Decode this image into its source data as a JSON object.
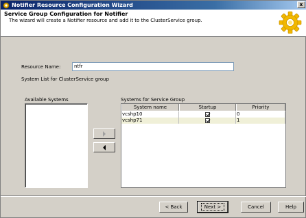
{
  "window": {
    "title": "Notifier Resource Configuration Wizard",
    "close_label": "x"
  },
  "header": {
    "title": "Service Group Configuration for Notifier",
    "subtitle": "The wizard will create a Notifier resource and add it to the ClusterService group."
  },
  "form": {
    "resource_name_label": "Resource Name:",
    "resource_name_value": "ntfr",
    "system_list_label": "System List for ClusterService group",
    "available_systems_label": "Available Systems",
    "systems_for_group_label": "Systems for Service Group"
  },
  "grid": {
    "columns": [
      "System name",
      "Startup",
      "Priority"
    ],
    "rows": [
      {
        "system": "vcshp10",
        "startup": true,
        "priority": "0"
      },
      {
        "system": "vcshp71",
        "startup": true,
        "priority": "1"
      }
    ]
  },
  "buttons": {
    "back": "< Back",
    "next": "Next >",
    "cancel": "Cancel",
    "help": "Help"
  },
  "icons": {
    "title": "wizard-icon",
    "header": "gear-icon",
    "add": "arrow-right-icon",
    "remove": "arrow-left-icon"
  },
  "colors": {
    "titlebar": "#0a246a",
    "row_alt": "#f0f0d8",
    "gear": "#f2b800"
  }
}
